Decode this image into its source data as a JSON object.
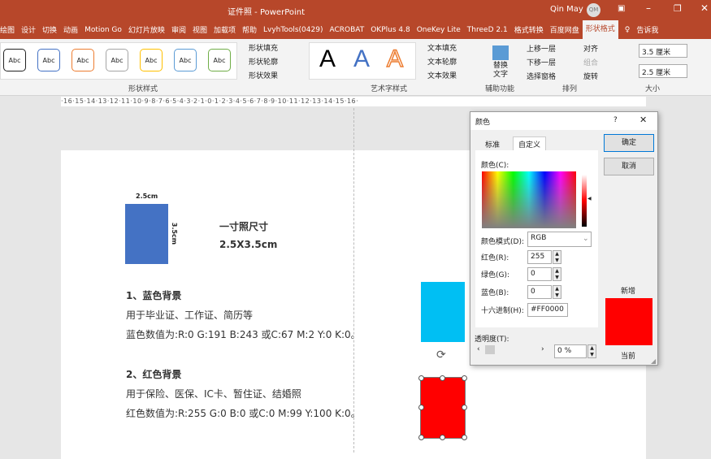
{
  "window": {
    "title": "证件照 - PowerPoint",
    "user": "Qin May",
    "avatar": "QM"
  },
  "tabs": [
    "绘图",
    "设计",
    "切换",
    "动画",
    "Motion Go",
    "幻灯片放映",
    "审阅",
    "视图",
    "加载项",
    "帮助",
    "LvyhTools(0429)",
    "ACROBAT",
    "OKPlus 4.8",
    "OneKey Lite",
    "ThreeD 2.1",
    "格式转换",
    "百度网盘",
    "形状格式",
    "告诉我"
  ],
  "ribbon": {
    "shape_style_samples": [
      "Abc",
      "Abc",
      "Abc",
      "Abc",
      "Abc",
      "Abc",
      "Abc"
    ],
    "shape_fill": "形状填充",
    "shape_outline": "形状轮廓",
    "shape_effect": "形状效果",
    "group_shape_styles": "形状样式",
    "art_letters": [
      "A",
      "A",
      "A"
    ],
    "text_fill": "文本填充",
    "text_outline": "文本轮廓",
    "text_effect": "文本效果",
    "group_art": "艺术字样式",
    "alt_text": "替换文字",
    "group_access": "辅助功能",
    "bring_forward": "上移一层",
    "send_backward": "下移一层",
    "selection_pane": "选择窗格",
    "align": "对齐",
    "group": "组合",
    "rotate": "旋转",
    "group_arrange": "排列",
    "height": "3.5 厘米",
    "width": "2.5 厘米",
    "group_size": "大小"
  },
  "ruler": "·16·15·14·13·12·11·10·9·8·7·6·5·4·3·2·1·0·1·2·3·4·5·6·7·8·9·10·11·12·13·14·15·16·",
  "slide": {
    "dim_width": "2.5cm",
    "dim_height": "3.5cm",
    "photo_title": "一寸照尺寸",
    "photo_size": "2.5X3.5cm",
    "blue_heading": "1、蓝色背景",
    "blue_use": "用于毕业证、工作证、简历等",
    "blue_values": "蓝色数值为:R:0 G:191 B:243 或C:67 M:2 Y:0 K:0。",
    "red_heading": "2、红色背景",
    "red_use": "用于保险、医保、IC卡、暂住证、结婚照",
    "red_values": "红色数值为:R:255 G:0 B:0 或C:0 M:99 Y:100 K:0。",
    "colors": {
      "photo": "#4472c4",
      "blue": "#00bff3",
      "red": "#ff0000"
    }
  },
  "dialog": {
    "title": "颜色",
    "help": "?",
    "tab_standard": "标准",
    "tab_custom": "自定义",
    "colors_label": "颜色(C):",
    "mode_label": "颜色模式(D):",
    "mode_value": "RGB",
    "red_label": "红色(R):",
    "red_value": "255",
    "green_label": "绿色(G):",
    "green_value": "0",
    "blue_label": "蓝色(B):",
    "blue_value": "0",
    "hex_label": "十六进制(H):",
    "hex_value": "#FF0000",
    "transparency_label": "透明度(T):",
    "transparency_value": "0 %",
    "ok": "确定",
    "cancel": "取消",
    "new_label": "新增",
    "current_label": "当前",
    "new_color": "#ff0000"
  }
}
